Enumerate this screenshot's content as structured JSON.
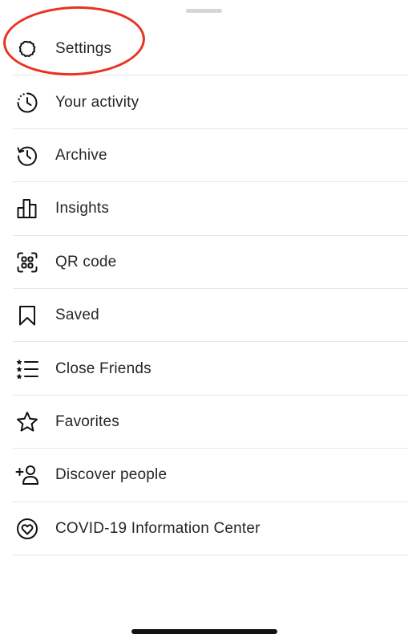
{
  "menu": {
    "items": [
      {
        "label": "Settings",
        "icon": "gear-icon"
      },
      {
        "label": "Your activity",
        "icon": "activity-clock-icon"
      },
      {
        "label": "Archive",
        "icon": "archive-history-icon"
      },
      {
        "label": "Insights",
        "icon": "bar-chart-icon"
      },
      {
        "label": "QR code",
        "icon": "qr-code-icon"
      },
      {
        "label": "Saved",
        "icon": "bookmark-icon"
      },
      {
        "label": "Close Friends",
        "icon": "star-list-icon"
      },
      {
        "label": "Favorites",
        "icon": "star-icon"
      },
      {
        "label": "Discover people",
        "icon": "add-person-icon"
      },
      {
        "label": "COVID-19 Information Center",
        "icon": "heart-circle-icon"
      }
    ]
  },
  "colors": {
    "text": "#262626",
    "icon": "#111111",
    "divider": "#e6e6e6",
    "highlight": "#e8321f",
    "grabber": "#d6d6d6"
  }
}
